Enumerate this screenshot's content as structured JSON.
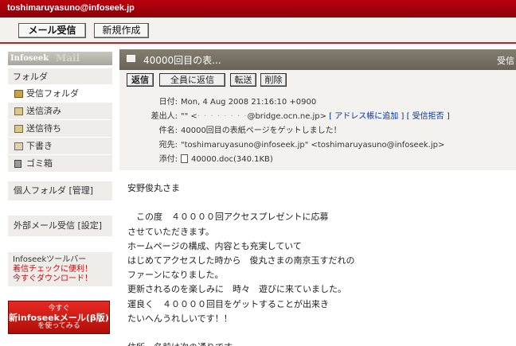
{
  "account": {
    "email": "toshimaruyasuno@infoseek.jp"
  },
  "toolbar": {
    "receive_label": "メール受信",
    "compose_label": "新規作成"
  },
  "sidebar": {
    "brand": "Infoseek",
    "brand_ghost": "Mail",
    "folders_heading": "フォルダ",
    "items": [
      {
        "label": "受信フォルダ",
        "icon": "inbox-icon"
      },
      {
        "label": "送信済み",
        "icon": "sent-icon"
      },
      {
        "label": "送信待ち",
        "icon": "outbox-icon"
      },
      {
        "label": "下書き",
        "icon": "draft-icon"
      },
      {
        "label": "ゴミ箱",
        "icon": "trash-icon"
      }
    ],
    "personal_folders": "個人フォルダ [管理]",
    "external_mail": "外部メール受信 [設定]",
    "promo": {
      "line1": "Infoseekツールバー",
      "line2": "着信チェックに便利！",
      "line3": "今すぐダウンロード！"
    },
    "beta_banner": {
      "line1": "今すぐ",
      "line2": "新infoseekメール(β版)",
      "line3": "を使ってみる"
    }
  },
  "message": {
    "title": "40000回目の表...",
    "right_text": "受信",
    "actions": {
      "reply": "返信",
      "reply_all": "全員に返信",
      "forward": "転送",
      "delete": "削除"
    },
    "headers": {
      "date_label": "日付:",
      "date_value": "Mon, 4 Aug 2008 21:16:10 +0900",
      "from_label": "差出人:",
      "from_name": "\"\" <",
      "from_blur": "· · · · · · · ·",
      "from_addr": "@bridge.ocn.ne.jp>",
      "from_add_link": "[ アドレス帳に追加 ]",
      "from_reject_link": "[ 受信拒否 ]",
      "subject_label": "件名:",
      "subject_value": "40000回目の表紙ページをゲットしました！",
      "to_label": "宛先:",
      "to_value": "\"toshimaruyasuno@infoseek.jp\" <toshimaruyasuno@infoseek.jp>",
      "attach_label": "添付:",
      "attach_value": "40000.doc(340.1KB)"
    },
    "body_lines": [
      "安野俊丸さま",
      "",
      "　この度　４００００回アクセスプレゼントに応募",
      "させていただきます。",
      "ホームページの構成、内容とも充実していて",
      "はじめてアクセスした時から　俊丸さまの南京玉すだれの",
      "ファーンになりました。",
      "更新されるのを楽しみに　時々　遊びに来ていました。",
      "運良く　４００００回目をゲットすることが出来き",
      "たいへんうれしいです！！",
      "",
      "住所　名前は次の通りです。"
    ]
  }
}
